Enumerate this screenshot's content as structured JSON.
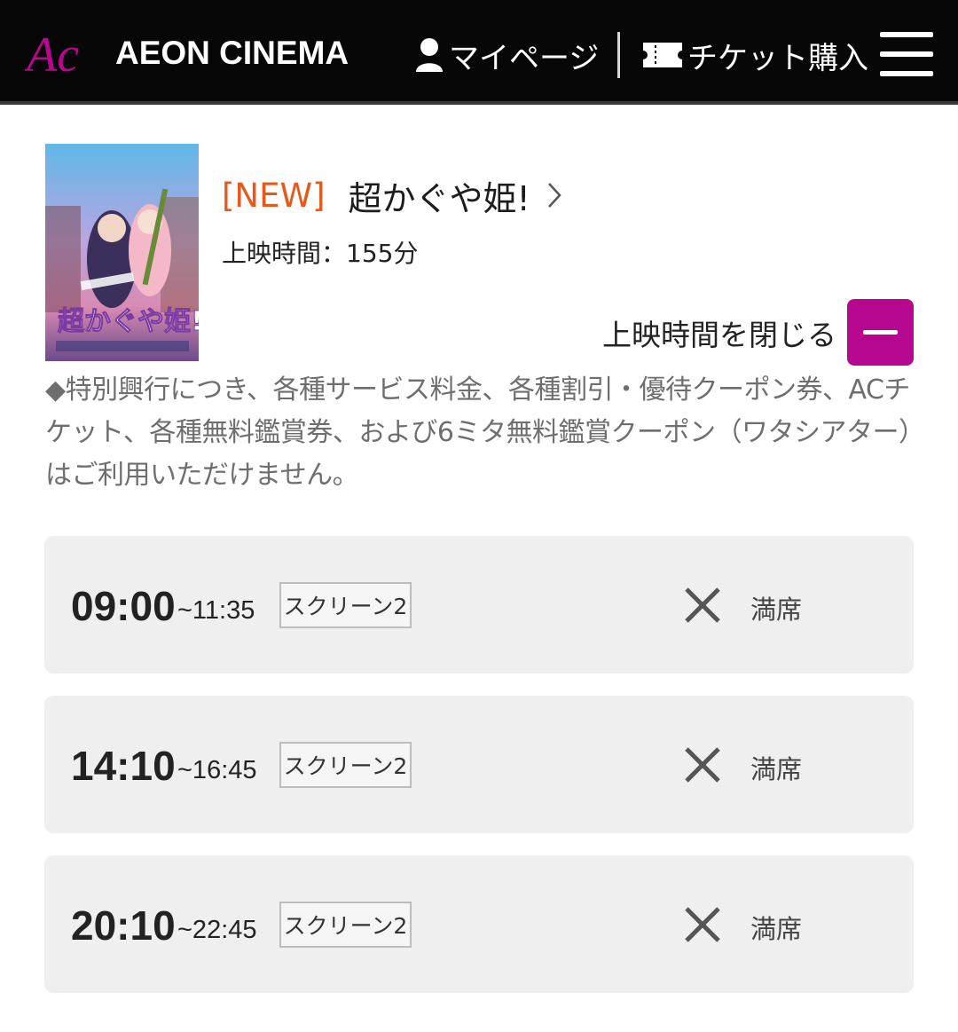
{
  "header": {
    "brand": "AEON CINEMA",
    "logo_mark": "Ac",
    "mypage_label": "マイページ",
    "ticket_label": "チケット購入",
    "brand_color": "#b5088f"
  },
  "movie": {
    "badge": "[NEW]",
    "title": "超かぐや姫!",
    "runtime": "上映時間：155分",
    "poster_caption": "超かぐや姫!",
    "toggle_label": "上映時間を閉じる",
    "notice": "◆特別興行につき、各種サービス料金、各種割引・優待クーポン券、ACチケット、各種無料鑑賞券、および6ミタ無料鑑賞クーポン（ワタシアター）はご利用いただけません。"
  },
  "showtimes": [
    {
      "start": "09:00",
      "end": "~11:35",
      "screen": "スクリーン2",
      "status": "満席"
    },
    {
      "start": "14:10",
      "end": "~16:45",
      "screen": "スクリーン2",
      "status": "満席"
    },
    {
      "start": "20:10",
      "end": "~22:45",
      "screen": "スクリーン2",
      "status": "満席"
    }
  ]
}
